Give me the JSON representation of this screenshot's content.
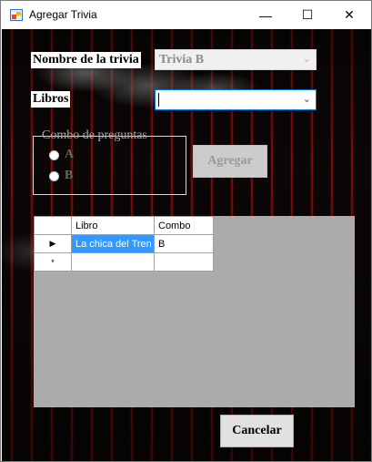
{
  "window": {
    "title": "Agregar Trivia",
    "controls": {
      "minimize": "—",
      "maximize": "☐",
      "close": "✕"
    }
  },
  "form": {
    "nombre_label": "Nombre de la trivia",
    "nombre_value": "Trivia B",
    "libros_label": "Libros",
    "libros_value": "",
    "group_title": "Combo de preguntas",
    "radio_a": "A",
    "radio_b": "B",
    "agregar_label": "Agregar",
    "cancelar_label": "Cancelar"
  },
  "grid": {
    "columns": [
      "Libro",
      "Combo"
    ],
    "rows": [
      {
        "marker": "▶",
        "libro": "La chica del Tren",
        "combo": "B"
      },
      {
        "marker": "*",
        "libro": "",
        "combo": ""
      }
    ]
  },
  "icons": {
    "dropdown": "chevron-down-icon",
    "app": "app-icon"
  }
}
